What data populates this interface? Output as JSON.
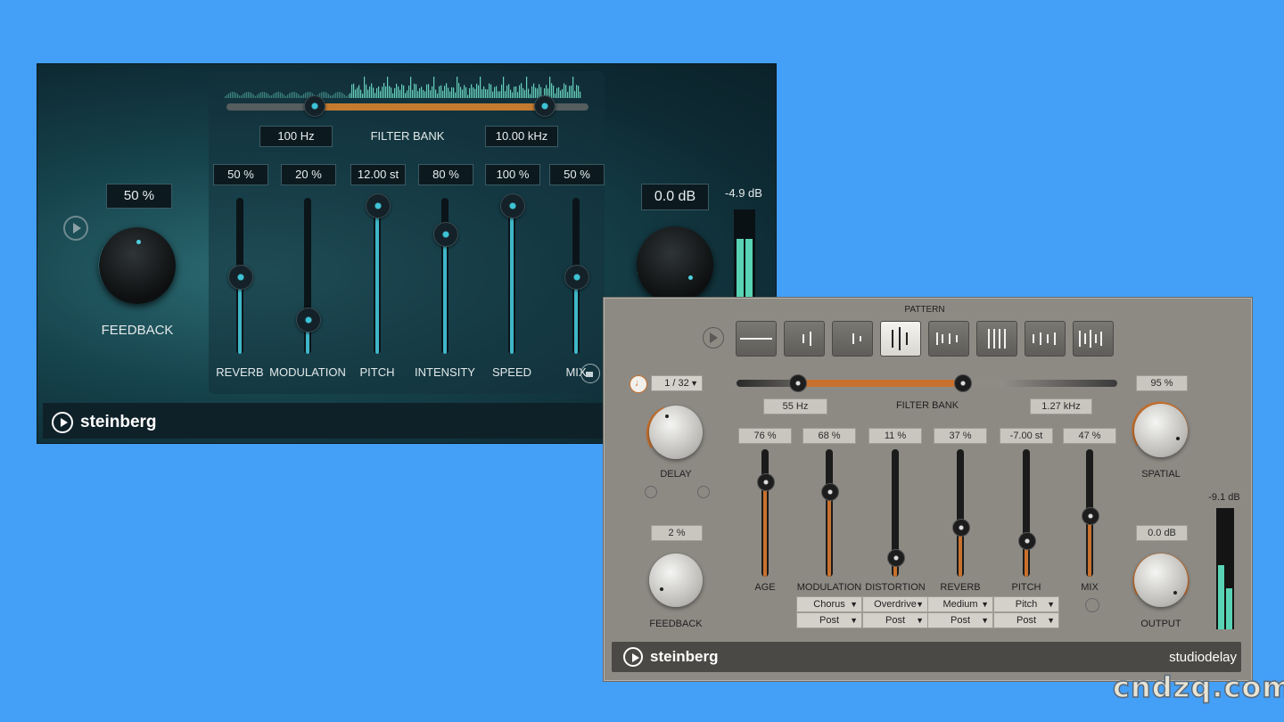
{
  "dark_plugin": {
    "filter_bank": {
      "label": "FILTER BANK",
      "low": "100 Hz",
      "high": "10.00 kHz"
    },
    "feedback": {
      "value": "50 %",
      "label": "FEEDBACK"
    },
    "output": {
      "value": "0.0 dB",
      "meter": "-4.9 dB"
    },
    "sliders": [
      {
        "label": "REVERB",
        "value": "50 %",
        "level": 0.5
      },
      {
        "label": "MODULATION",
        "value": "20 %",
        "level": 0.2
      },
      {
        "label": "PITCH",
        "value": "12.00 st",
        "level": 1.0
      },
      {
        "label": "INTENSITY",
        "value": "80 %",
        "level": 0.8
      },
      {
        "label": "SPEED",
        "value": "100 %",
        "level": 1.0
      },
      {
        "label": "MIX",
        "value": "50 %",
        "level": 0.5
      }
    ],
    "brand": "steinberg"
  },
  "grey_plugin": {
    "pattern_label": "PATTERN",
    "delay": {
      "sync": "1 / 32",
      "label": "DELAY"
    },
    "feedback": {
      "value": "2 %",
      "label": "FEEDBACK"
    },
    "filter_bank": {
      "label": "FILTER BANK",
      "low": "55 Hz",
      "high": "1.27 kHz"
    },
    "spatial": {
      "value": "95 %",
      "label": "SPATIAL"
    },
    "output": {
      "value": "0.0 dB",
      "label": "OUTPUT",
      "meter": "-9.1 dB"
    },
    "sliders": [
      {
        "label": "AGE",
        "value": "76 %",
        "level": 0.76
      },
      {
        "label": "MODULATION",
        "value": "68 %",
        "level": 0.68,
        "type": "Chorus",
        "routing": "Post"
      },
      {
        "label": "DISTORTION",
        "value": "11 %",
        "level": 0.11,
        "type": "Overdrive",
        "routing": "Post"
      },
      {
        "label": "REVERB",
        "value": "37 %",
        "level": 0.37,
        "type": "Medium",
        "routing": "Post"
      },
      {
        "label": "PITCH",
        "value": "-7.00 st",
        "level": 0.25,
        "type": "Pitch",
        "routing": "Post"
      },
      {
        "label": "MIX",
        "value": "47 %",
        "level": 0.47
      }
    ],
    "brand": "steinberg",
    "product": "studiodelay"
  },
  "watermark": "cndzq.com",
  "colors": {
    "background": "#449ff7",
    "dark_accent": "#3fb6c8",
    "grey_accent": "#c8712e"
  }
}
